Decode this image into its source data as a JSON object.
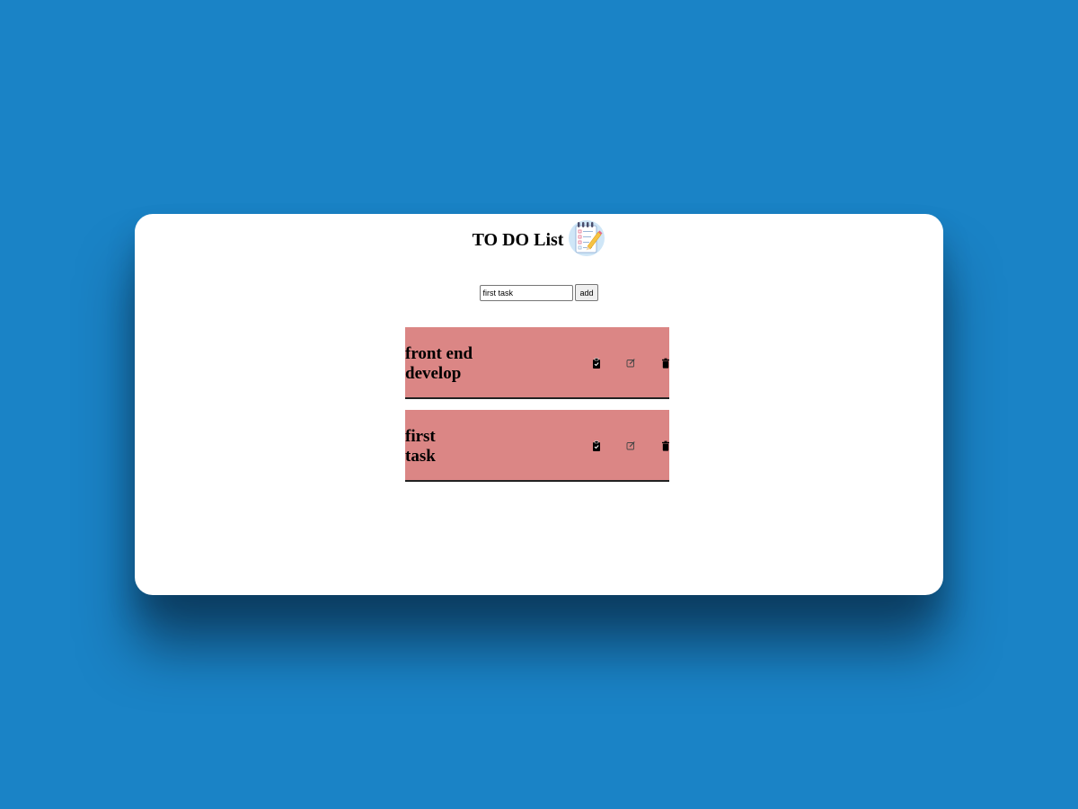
{
  "app": {
    "title": "TO DO List",
    "logo_icon": "notepad-checklist-icon"
  },
  "form": {
    "input_value": "first task",
    "add_label": "add"
  },
  "tasks": [
    {
      "text": "front end develop"
    },
    {
      "text": "first task"
    }
  ],
  "icons": {
    "complete": "clipboard-check-icon",
    "edit": "edit-icon",
    "delete": "trash-icon"
  },
  "colors": {
    "background": "#1a83c6",
    "card": "#ffffff",
    "task_background": "#db8685"
  }
}
